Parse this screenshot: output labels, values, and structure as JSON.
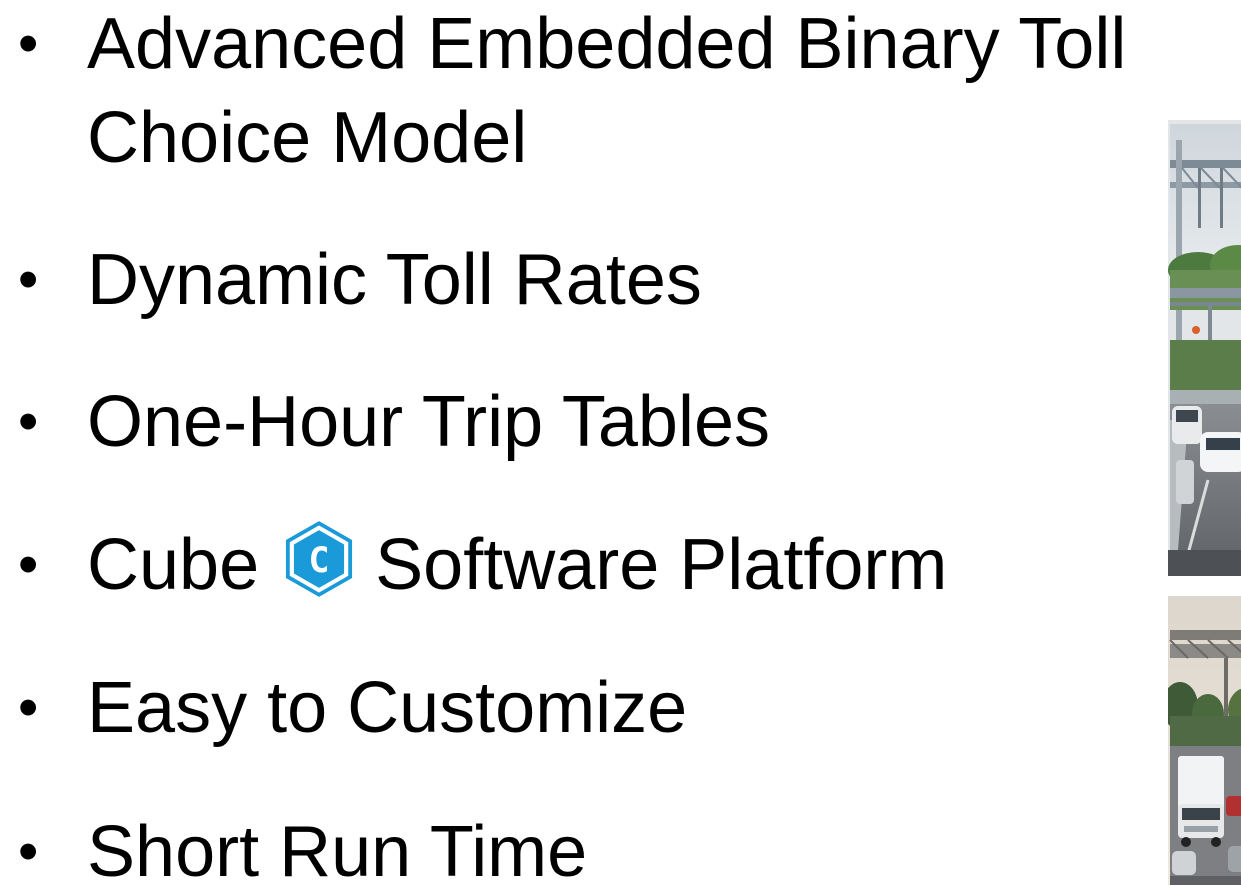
{
  "bullets": [
    {
      "lines": [
        "Advanced Embedded Binary Toll",
        "Choice Model"
      ]
    },
    {
      "lines": [
        "Dynamic Toll Rates"
      ]
    },
    {
      "lines": [
        "One-Hour Trip Tables"
      ]
    },
    {
      "before_logo": "Cube",
      "logo_letter": "C",
      "after_logo": "Software Platform"
    },
    {
      "lines": [
        "Easy to Customize"
      ]
    },
    {
      "lines": [
        "Short Run Time"
      ]
    }
  ],
  "bullet_glyph": "•",
  "logo": {
    "icon": "cube-hexagon-logo",
    "fill": "#1a9ad9",
    "letter_color": "#ffffff"
  },
  "photos": [
    {
      "icon": "highway-toll-gantry-photo"
    },
    {
      "icon": "highway-traffic-truck-photo"
    }
  ]
}
